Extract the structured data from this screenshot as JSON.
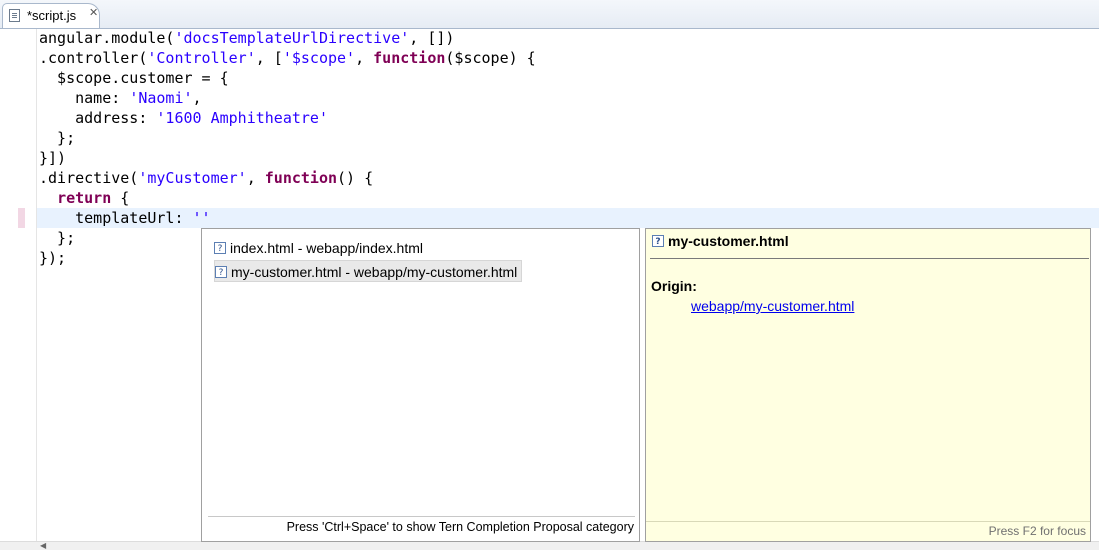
{
  "tab": {
    "label": "*script.js",
    "file_icon": "js-file-icon",
    "close_icon": "close-icon"
  },
  "editor": {
    "lines": [
      [
        {
          "t": "angular.module("
        },
        {
          "t": "'docsTemplateUrlDirective'",
          "c": "str"
        },
        {
          "t": ", [])"
        }
      ],
      [
        {
          "t": ".controller("
        },
        {
          "t": "'Controller'",
          "c": "str"
        },
        {
          "t": ", ["
        },
        {
          "t": "'$scope'",
          "c": "str"
        },
        {
          "t": ", "
        },
        {
          "t": "function",
          "c": "kw"
        },
        {
          "t": "($scope) {"
        }
      ],
      [
        {
          "t": "  $scope.customer = {"
        }
      ],
      [
        {
          "t": "    name: "
        },
        {
          "t": "'Naomi'",
          "c": "str"
        },
        {
          "t": ","
        }
      ],
      [
        {
          "t": "    address: "
        },
        {
          "t": "'1600 Amphitheatre'",
          "c": "str"
        }
      ],
      [
        {
          "t": "  };"
        }
      ],
      [
        {
          "t": "}])"
        }
      ],
      [
        {
          "t": ".directive("
        },
        {
          "t": "'myCustomer'",
          "c": "str"
        },
        {
          "t": ", "
        },
        {
          "t": "function",
          "c": "kw"
        },
        {
          "t": "() {"
        }
      ],
      [
        {
          "t": "  "
        },
        {
          "t": "return",
          "c": "kw"
        },
        {
          "t": " {"
        }
      ],
      [
        {
          "t": "    templateUrl: "
        },
        {
          "t": "''",
          "c": "str"
        }
      ],
      [
        {
          "t": "  };"
        }
      ],
      [
        {
          "t": "});"
        }
      ]
    ]
  },
  "completion": {
    "proposals": [
      {
        "label": "index.html - webapp/index.html",
        "icon": "help-icon"
      },
      {
        "label": "my-customer.html - webapp/my-customer.html",
        "icon": "help-icon",
        "selected": true
      }
    ],
    "status": "Press 'Ctrl+Space' to show Tern Completion Proposal category"
  },
  "info": {
    "title": "my-customer.html",
    "icon": "help-icon",
    "origin_label": "Origin:",
    "origin_link": "webapp/my-customer.html",
    "status": "Press F2 for focus"
  },
  "colors": {
    "string": "#2a00ff",
    "keyword": "#7f0055",
    "current_line": "#e8f2fe",
    "info_background": "#ffffe1"
  }
}
